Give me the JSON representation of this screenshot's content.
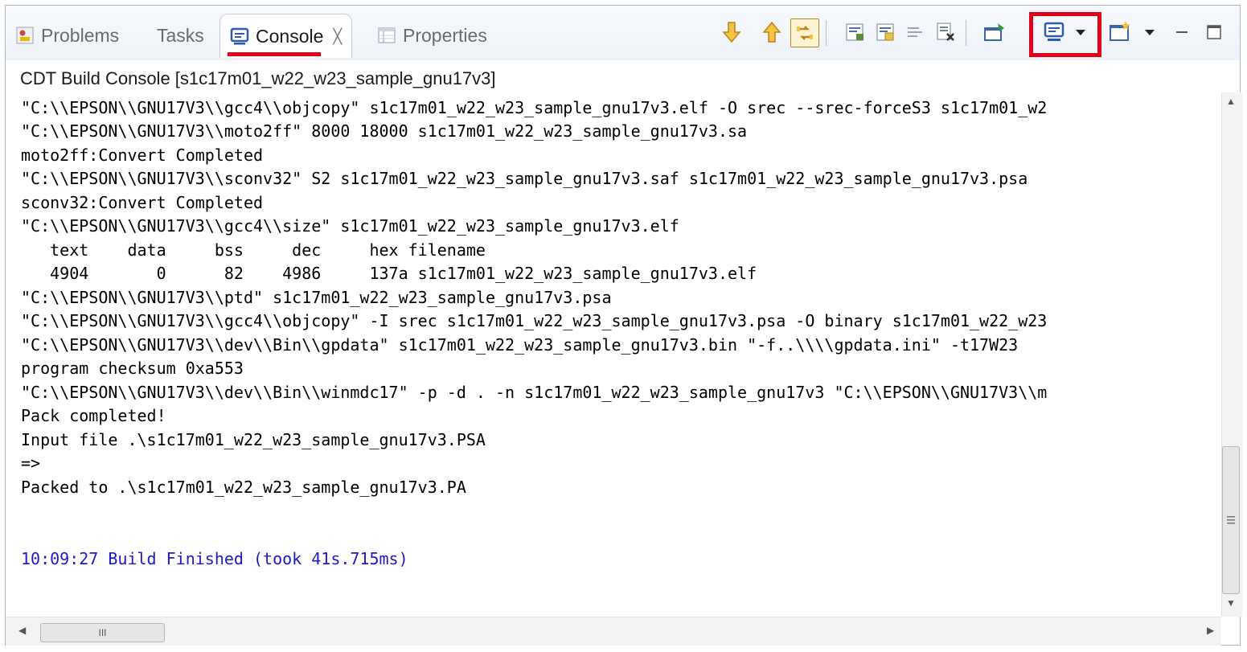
{
  "tabs": {
    "problems": "Problems",
    "tasks": "Tasks",
    "console": "Console",
    "console_close": "╳",
    "properties": "Properties"
  },
  "console_title": "CDT Build Console [s1c17m01_w22_w23_sample_gnu17v3]",
  "lines": [
    "\"C:\\\\EPSON\\\\GNU17V3\\\\gcc4\\\\objcopy\" s1c17m01_w22_w23_sample_gnu17v3.elf -O srec --srec-forceS3 s1c17m01_w2",
    "\"C:\\\\EPSON\\\\GNU17V3\\\\moto2ff\" 8000 18000 s1c17m01_w22_w23_sample_gnu17v3.sa",
    "moto2ff:Convert Completed",
    "\"C:\\\\EPSON\\\\GNU17V3\\\\sconv32\" S2 s1c17m01_w22_w23_sample_gnu17v3.saf s1c17m01_w22_w23_sample_gnu17v3.psa",
    "sconv32:Convert Completed",
    "\"C:\\\\EPSON\\\\GNU17V3\\\\gcc4\\\\size\" s1c17m01_w22_w23_sample_gnu17v3.elf",
    "   text    data     bss     dec     hex filename",
    "   4904       0      82    4986     137a s1c17m01_w22_w23_sample_gnu17v3.elf",
    "\"C:\\\\EPSON\\\\GNU17V3\\\\ptd\" s1c17m01_w22_w23_sample_gnu17v3.psa",
    "\"C:\\\\EPSON\\\\GNU17V3\\\\gcc4\\\\objcopy\" -I srec s1c17m01_w22_w23_sample_gnu17v3.psa -O binary s1c17m01_w22_w23",
    "\"C:\\\\EPSON\\\\GNU17V3\\\\dev\\\\Bin\\\\gpdata\" s1c17m01_w22_w23_sample_gnu17v3.bin \"-f..\\\\\\\\gpdata.ini\" -t17W23",
    "program checksum 0xa553",
    "\"C:\\\\EPSON\\\\GNU17V3\\\\dev\\\\Bin\\\\winmdc17\" -p -d . -n s1c17m01_w22_w23_sample_gnu17v3 \"C:\\\\EPSON\\\\GNU17V3\\\\m",
    "Pack completed!",
    "Input file .\\s1c17m01_w22_w23_sample_gnu17v3.PSA",
    "=>",
    "Packed to .\\s1c17m01_w22_w23_sample_gnu17v3.PA",
    "",
    "",
    "10:09:27 Build Finished (took 41s.715ms)"
  ],
  "hscroll_thumb_label": "III",
  "colors": {
    "highlight": "#e0001a",
    "build_finished": "#1a1acc"
  }
}
